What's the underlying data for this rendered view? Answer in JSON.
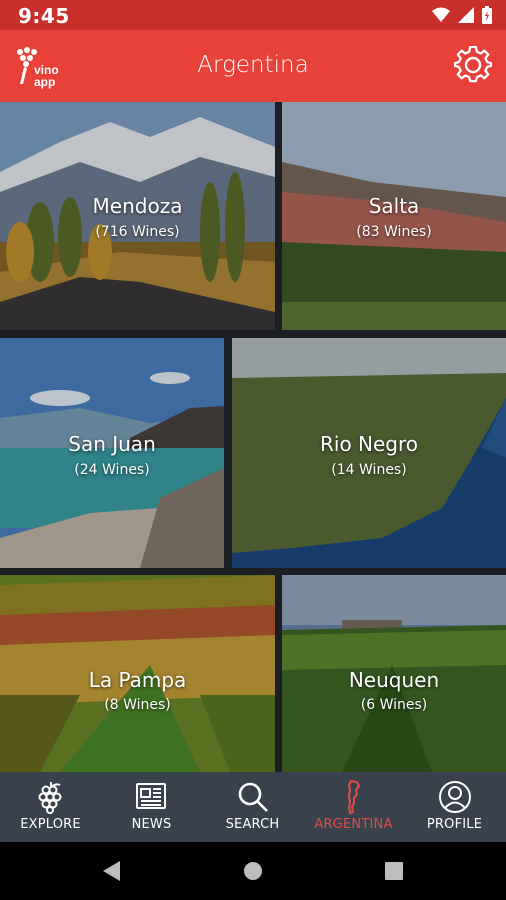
{
  "status_bar": {
    "time": "9:45"
  },
  "app_bar": {
    "title": "Argentina",
    "logo_text": "vino app"
  },
  "regions": [
    {
      "name": "Mendoza",
      "count": "(716 Wines)"
    },
    {
      "name": "Salta",
      "count": "(83 Wines)"
    },
    {
      "name": "San Juan",
      "count": "(24 Wines)"
    },
    {
      "name": "Rio Negro",
      "count": "(14 Wines)"
    },
    {
      "name": "La Pampa",
      "count": "(8 Wines)"
    },
    {
      "name": "Neuquen",
      "count": "(6 Wines)"
    }
  ],
  "bottom_nav": [
    {
      "label": "EXPLORE",
      "icon": "grapes-icon"
    },
    {
      "label": "NEWS",
      "icon": "newspaper-icon"
    },
    {
      "label": "SEARCH",
      "icon": "search-icon"
    },
    {
      "label": "ARGENTINA",
      "icon": "argentina-map-icon",
      "active": true
    },
    {
      "label": "PROFILE",
      "icon": "profile-icon"
    }
  ],
  "colors": {
    "primary": "#e8413a",
    "status": "#c9302c",
    "nav_bg": "#38414c",
    "active": "#e24a44"
  }
}
